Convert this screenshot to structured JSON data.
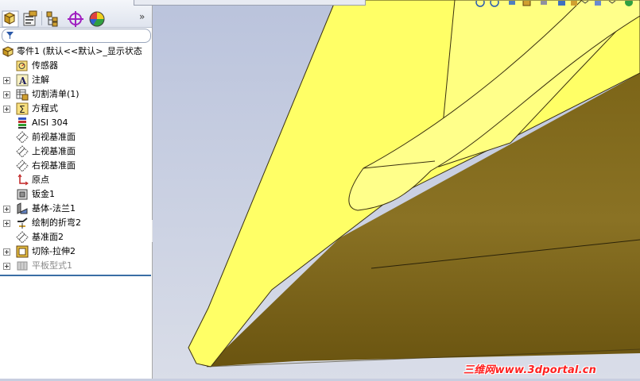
{
  "feature_manager": {
    "tabs": [
      {
        "name": "feature-tree-tab"
      },
      {
        "name": "property-manager-tab"
      },
      {
        "name": "configuration-manager-tab"
      },
      {
        "name": "dimxpert-tab"
      },
      {
        "name": "display-manager-tab"
      }
    ],
    "more_glyph": "»",
    "filter_placeholder": "",
    "root_label": "零件1  (默认<<默认>_显示状态",
    "items": [
      {
        "label": "传感器",
        "icon": "sensor-icon",
        "expandable": false,
        "suppressed": false
      },
      {
        "label": "注解",
        "icon": "annotation-icon",
        "expandable": true,
        "suppressed": false
      },
      {
        "label": "切割清单(1)",
        "icon": "cut-list-icon",
        "expandable": true,
        "suppressed": false
      },
      {
        "label": "方程式",
        "icon": "equation-icon",
        "expandable": true,
        "suppressed": false
      },
      {
        "label": "AISI 304",
        "icon": "material-icon",
        "expandable": false,
        "suppressed": false
      },
      {
        "label": "前视基准面",
        "icon": "plane-icon",
        "expandable": false,
        "suppressed": false
      },
      {
        "label": "上视基准面",
        "icon": "plane-icon",
        "expandable": false,
        "suppressed": false
      },
      {
        "label": "右视基准面",
        "icon": "plane-icon",
        "expandable": false,
        "suppressed": false
      },
      {
        "label": "原点",
        "icon": "origin-icon",
        "expandable": false,
        "suppressed": false
      },
      {
        "label": "钣金1",
        "icon": "sheet-metal-icon",
        "expandable": false,
        "suppressed": false
      },
      {
        "label": "基体-法兰1",
        "icon": "base-flange-icon",
        "expandable": true,
        "suppressed": false
      },
      {
        "label": "绘制的折弯2",
        "icon": "sketched-bend-icon",
        "expandable": true,
        "suppressed": false
      },
      {
        "label": "基准面2",
        "icon": "plane-icon",
        "expandable": false,
        "suppressed": false
      },
      {
        "label": "切除-拉伸2",
        "icon": "cut-extrude-icon",
        "expandable": true,
        "suppressed": false
      },
      {
        "label": "平板型式1",
        "icon": "flat-pattern-icon",
        "expandable": true,
        "suppressed": true
      }
    ]
  },
  "viewport": {
    "background_top": "#c3cbe0",
    "background_bottom": "#d8dce8",
    "part_face_color": "#ffff66",
    "part_edge_color": "#5a4a10",
    "part_side_color": "#7a6418"
  },
  "watermark": "三维网www.3dportal.cn"
}
